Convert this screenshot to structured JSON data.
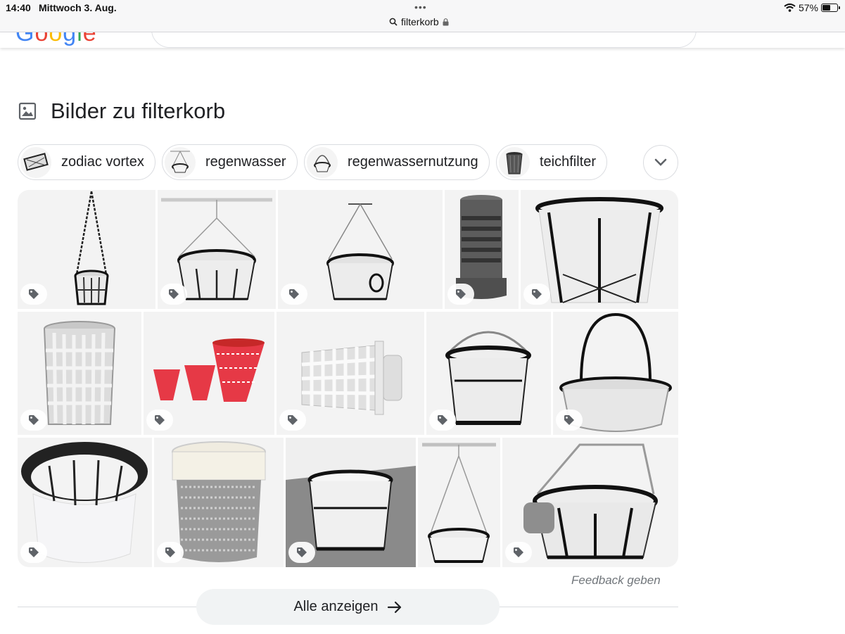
{
  "status_bar": {
    "time": "14:40",
    "date": "Mittwoch 3. Aug.",
    "url": "filterkorb",
    "battery": "57%"
  },
  "section": {
    "title": "Bilder zu filterkorb"
  },
  "chips": [
    {
      "label": "zodiac vortex"
    },
    {
      "label": "regenwasser"
    },
    {
      "label": "regenwassernutzung"
    },
    {
      "label": "teichfilter"
    }
  ],
  "footer": {
    "feedback": "Feedback geben",
    "show_all": "Alle anzeigen"
  },
  "colors": {
    "accent_blue": "#4285f4",
    "tile_bg": "#f3f3f3",
    "chip_border": "#dadce0"
  }
}
